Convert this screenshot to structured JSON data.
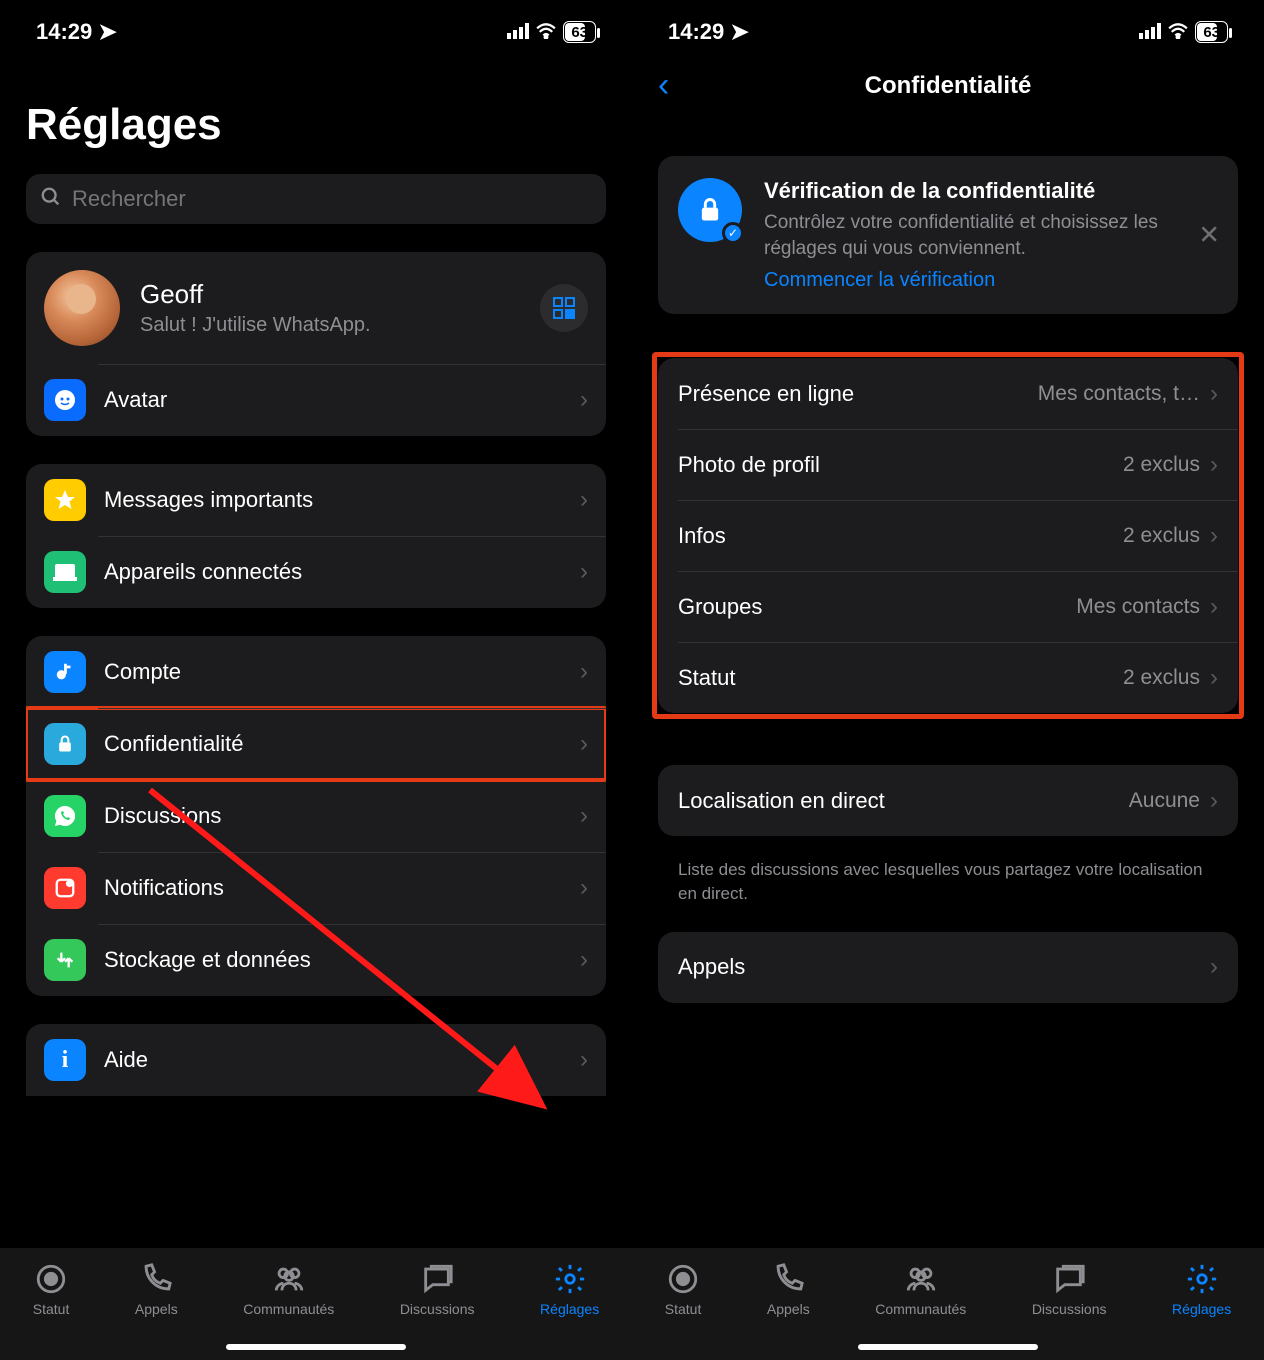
{
  "statusbar": {
    "time": "14:29",
    "battery": "63"
  },
  "left": {
    "title": "Réglages",
    "search_placeholder": "Rechercher",
    "profile": {
      "name": "Geoff",
      "sub": "Salut ! J'utilise WhatsApp."
    },
    "avatar_row": "Avatar",
    "group2": {
      "starred": "Messages importants",
      "linked": "Appareils connectés"
    },
    "group3": {
      "account": "Compte",
      "privacy": "Confidentialité",
      "chats": "Discussions",
      "notifications": "Notifications",
      "storage": "Stockage et données"
    },
    "group4": {
      "help": "Aide"
    }
  },
  "right": {
    "title": "Confidentialité",
    "banner": {
      "title": "Vérification de la confidentialité",
      "body": "Contrôlez votre confidentialité et choisissez les réglages qui vous conviennent.",
      "link": "Commencer la vérification"
    },
    "rows": [
      {
        "label": "Présence en ligne",
        "value": "Mes contacts, t…"
      },
      {
        "label": "Photo de profil",
        "value": "2 exclus"
      },
      {
        "label": "Infos",
        "value": "2 exclus"
      },
      {
        "label": "Groupes",
        "value": "Mes contacts"
      },
      {
        "label": "Statut",
        "value": "2 exclus"
      }
    ],
    "location": {
      "label": "Localisation en direct",
      "value": "Aucune"
    },
    "location_footer": "Liste des discussions avec lesquelles vous partagez votre localisation en direct.",
    "calls": {
      "label": "Appels"
    }
  },
  "tabs": {
    "status": "Statut",
    "calls": "Appels",
    "communities": "Communautés",
    "chats": "Discussions",
    "settings": "Réglages"
  }
}
